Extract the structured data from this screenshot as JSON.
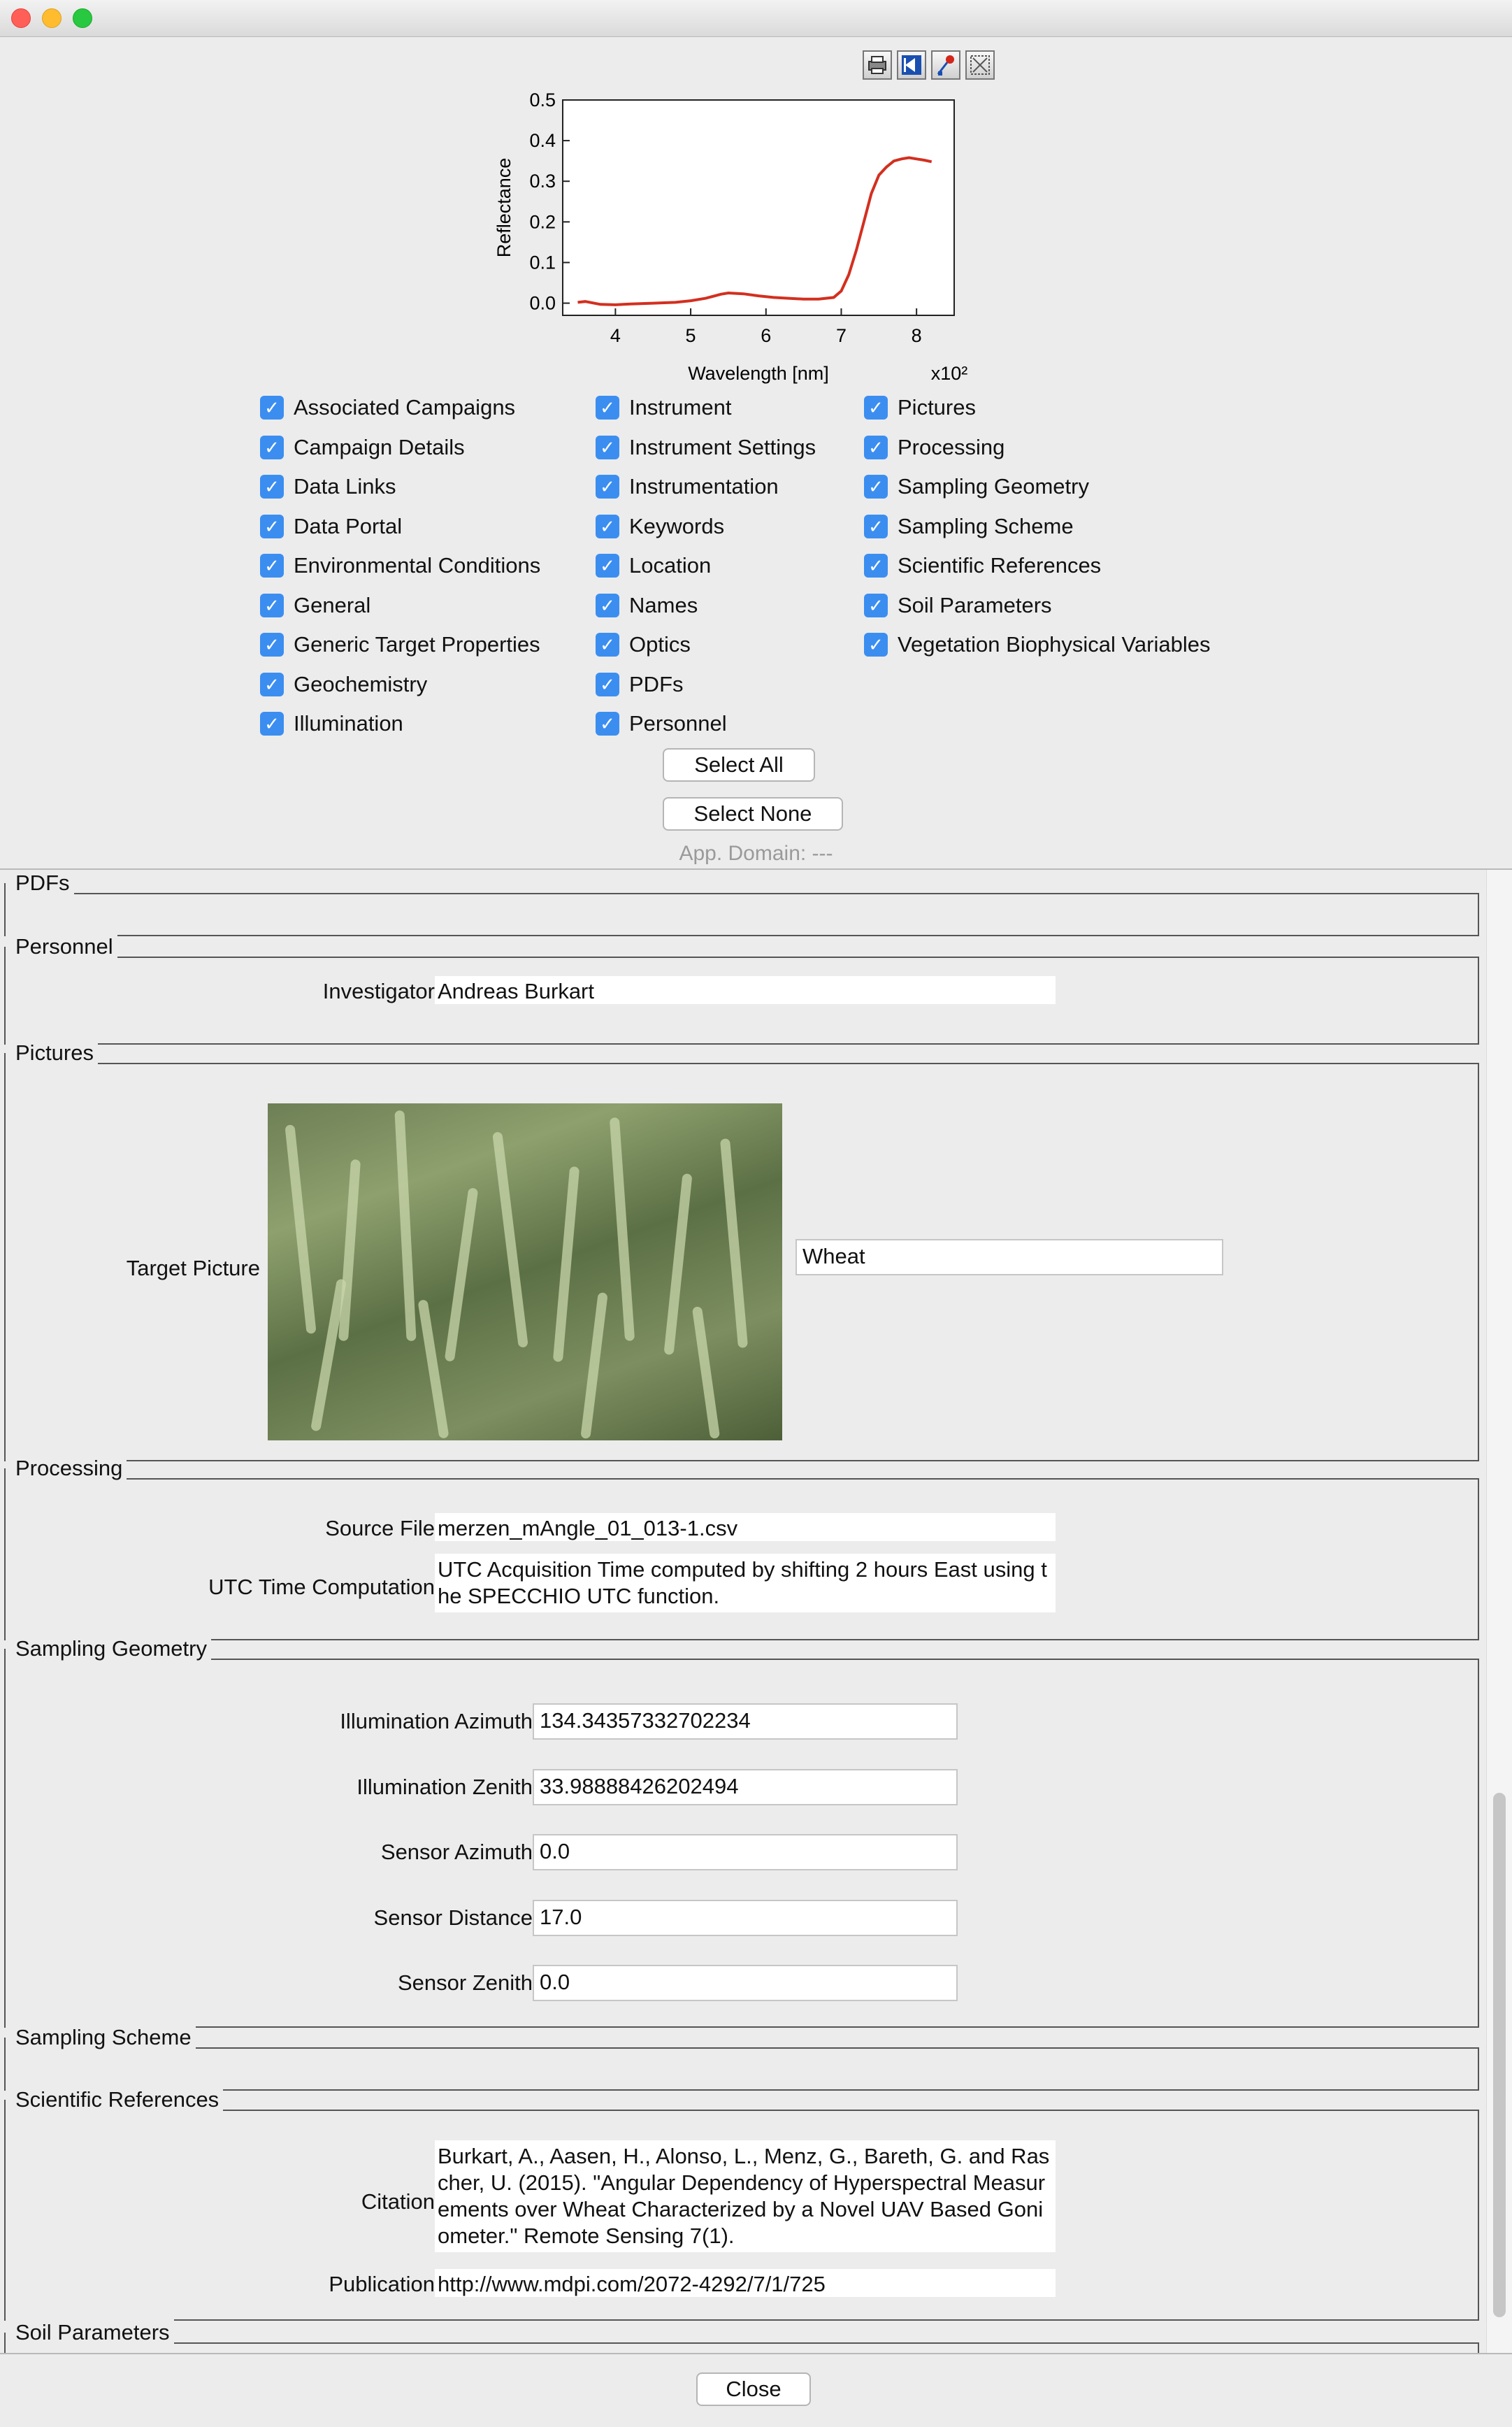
{
  "window": {
    "title": ""
  },
  "toolbar": {
    "icons": [
      "print-icon",
      "zoom-back-icon",
      "pin-icon",
      "fit-icon"
    ]
  },
  "chart_data": {
    "type": "line",
    "xlabel": "Wavelength [nm]",
    "ylabel": "Reflectance",
    "x_multiplier": "x10²",
    "xlim": [
      3.3,
      8.5
    ],
    "ylim": [
      -0.03,
      0.5
    ],
    "xticks": [
      "4",
      "5",
      "6",
      "7",
      "8"
    ],
    "yticks": [
      "0.0",
      "0.1",
      "0.2",
      "0.3",
      "0.4",
      "0.5"
    ],
    "series": [
      {
        "color": "#d32f1f",
        "points": [
          [
            3.5,
            0.002
          ],
          [
            3.6,
            0.004
          ],
          [
            3.8,
            -0.003
          ],
          [
            4.0,
            -0.004
          ],
          [
            4.2,
            -0.002
          ],
          [
            4.5,
            0.0
          ],
          [
            4.8,
            0.002
          ],
          [
            5.0,
            0.006
          ],
          [
            5.2,
            0.012
          ],
          [
            5.4,
            0.022
          ],
          [
            5.5,
            0.025
          ],
          [
            5.7,
            0.023
          ],
          [
            5.9,
            0.018
          ],
          [
            6.1,
            0.014
          ],
          [
            6.3,
            0.012
          ],
          [
            6.5,
            0.01
          ],
          [
            6.7,
            0.01
          ],
          [
            6.9,
            0.014
          ],
          [
            7.0,
            0.03
          ],
          [
            7.1,
            0.07
          ],
          [
            7.2,
            0.13
          ],
          [
            7.3,
            0.2
          ],
          [
            7.4,
            0.27
          ],
          [
            7.5,
            0.315
          ],
          [
            7.6,
            0.335
          ],
          [
            7.7,
            0.35
          ],
          [
            7.8,
            0.355
          ],
          [
            7.9,
            0.358
          ],
          [
            8.0,
            0.355
          ],
          [
            8.1,
            0.352
          ],
          [
            8.2,
            0.348
          ]
        ]
      }
    ]
  },
  "checkboxes": {
    "col1": [
      "Associated Campaigns",
      "Campaign Details",
      "Data Links",
      "Data Portal",
      "Environmental Conditions",
      "General",
      "Generic Target Properties",
      "Geochemistry",
      "Illumination"
    ],
    "col2": [
      "Instrument",
      "Instrument Settings",
      "Instrumentation",
      "Keywords",
      "Location",
      "Names",
      "Optics",
      "PDFs",
      "Personnel"
    ],
    "col3": [
      "Pictures",
      "Processing",
      "Sampling Geometry",
      "Sampling Scheme",
      "Scientific References",
      "Soil Parameters",
      "Vegetation Biophysical Variables"
    ],
    "checked": true
  },
  "buttons": {
    "select_all": "Select All",
    "select_none": "Select None",
    "close": "Close"
  },
  "app_domain": "App. Domain: ---",
  "sections": {
    "pdfs": {
      "title": "PDFs"
    },
    "personnel": {
      "title": "Personnel",
      "investigator_label": "Investigator",
      "investigator_value": "Andreas Burkart"
    },
    "pictures": {
      "title": "Pictures",
      "target_picture_label": "Target Picture",
      "caption": "Wheat"
    },
    "processing": {
      "title": "Processing",
      "source_file_label": "Source File",
      "source_file_value": "merzen_mAngle_01_013-1.csv",
      "utc_label": "UTC Time Computation",
      "utc_value": "UTC Acquisition Time computed by shifting 2 hours East using the SPECCHIO UTC function."
    },
    "sampling_geometry": {
      "title": "Sampling Geometry",
      "fields": [
        {
          "label": "Illumination Azimuth",
          "value": "134.34357332702234"
        },
        {
          "label": "Illumination Zenith",
          "value": "33.98888426202494"
        },
        {
          "label": "Sensor Azimuth",
          "value": "0.0"
        },
        {
          "label": "Sensor Distance",
          "value": "17.0"
        },
        {
          "label": "Sensor Zenith",
          "value": "0.0"
        }
      ]
    },
    "sampling_scheme": {
      "title": "Sampling Scheme"
    },
    "scientific_references": {
      "title": "Scientific References",
      "citation_label": "Citation",
      "citation_value": "Burkart, A., Aasen, H., Alonso, L., Menz, G., Bareth, G. and Rascher, U. (2015). \"Angular Dependency of Hyperspectral Measurements over Wheat Characterized by a Novel UAV Based Goniometer.\" Remote Sensing 7(1).",
      "publication_label": "Publication",
      "publication_value": "http://www.mdpi.com/2072-4292/7/1/725"
    },
    "soil_parameters": {
      "title": "Soil Parameters"
    }
  }
}
